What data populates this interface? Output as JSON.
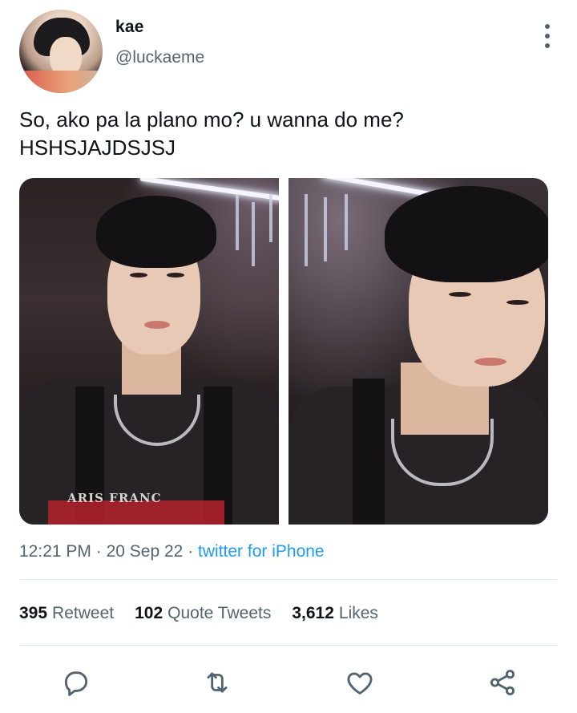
{
  "user": {
    "display_name": "kae",
    "handle": "@luckaeme"
  },
  "tweet": {
    "text": "So, ako pa la plano mo? u wanna do me?\nHSHSJAJDSJSJ",
    "media": [
      {
        "photo_print_text": "ARIS FRANC"
      },
      {}
    ]
  },
  "meta": {
    "time": "12:21 PM",
    "separator": "·",
    "date": "20 Sep 22",
    "source": "twitter for iPhone"
  },
  "stats": {
    "retweets": {
      "count": "395",
      "label": "Retweet"
    },
    "quotes": {
      "count": "102",
      "label": "Quote Tweets"
    },
    "likes": {
      "count": "3,612",
      "label": "Likes"
    }
  },
  "actions": [
    "reply-icon",
    "retweet-icon",
    "like-icon",
    "share-icon"
  ],
  "colors": {
    "link": "#1d9bf0",
    "secondary_text": "#536471",
    "primary_text": "#0f1419",
    "icon": "#536471"
  }
}
